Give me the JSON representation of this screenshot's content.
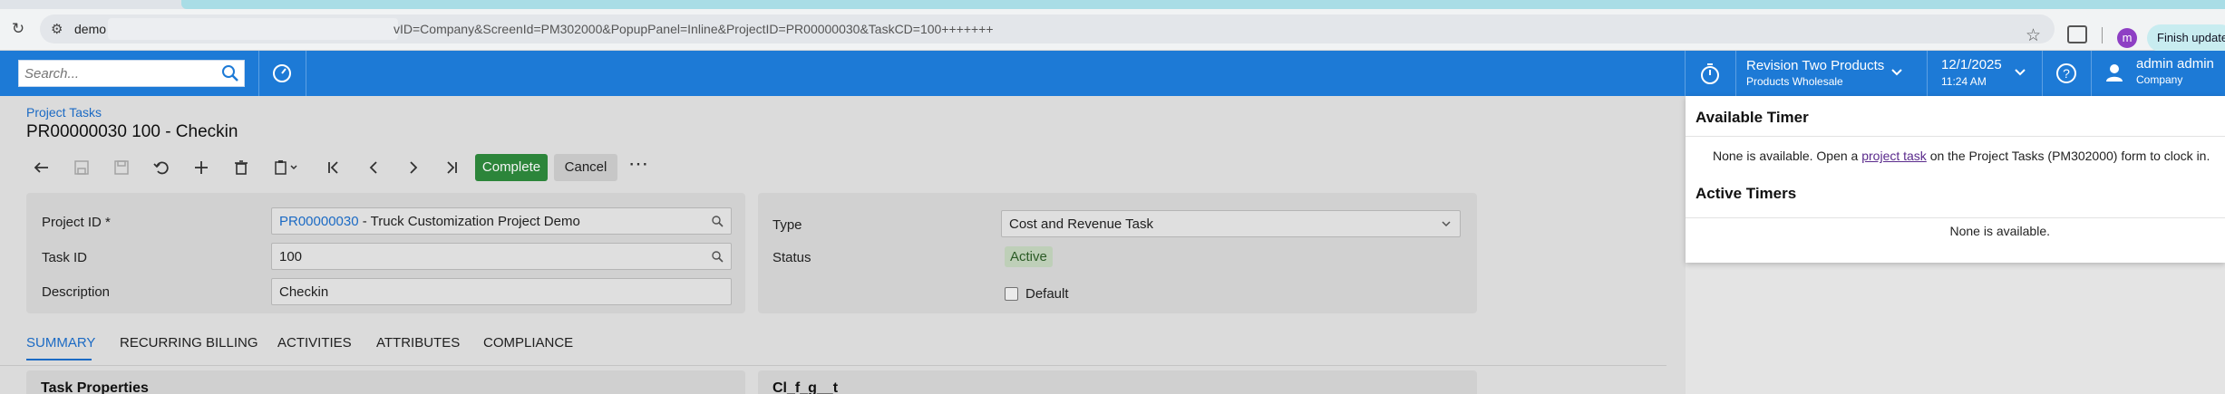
{
  "browser": {
    "url_host": "demo",
    "url_path": "vID=Company&ScreenId=PM302000&PopupPanel=Inline&ProjectID=PR00000030&TaskCD=100+++++++",
    "profile_initial": "m",
    "finish_update_label": "Finish update"
  },
  "header": {
    "search_placeholder": "Search...",
    "company_name": "Revision Two Products",
    "company_branch": "Products Wholesale",
    "date": "12/1/2025",
    "time": "11:24 AM",
    "user_name": "admin admin",
    "user_company": "Company"
  },
  "page": {
    "breadcrumb": "Project Tasks",
    "title": "PR00000030 100 - Checkin"
  },
  "toolbar": {
    "complete_label": "Complete",
    "cancel_label": "Cancel",
    "more_label": "⋯"
  },
  "form": {
    "project_id_label": "Project ID *",
    "project_id_value": "PR00000030",
    "project_id_desc": " - Truck Customization Project Demo",
    "task_id_label": "Task ID",
    "task_id_value": "100",
    "description_label": "Description",
    "description_value": "Checkin",
    "type_label": "Type",
    "type_value": "Cost and Revenue Task",
    "status_label": "Status",
    "status_value": "Active",
    "default_label": "Default"
  },
  "tabs": [
    {
      "label": "SUMMARY",
      "active": true
    },
    {
      "label": "RECURRING BILLING",
      "active": false
    },
    {
      "label": "ACTIVITIES",
      "active": false
    },
    {
      "label": "ATTRIBUTES",
      "active": false
    },
    {
      "label": "COMPLIANCE",
      "active": false
    }
  ],
  "sections": {
    "left_title": "Task Properties",
    "right_title": "Cl_f_g__t"
  },
  "popup": {
    "available_title": "Available Timer",
    "available_msg_pre": "None is available. Open a ",
    "available_msg_link": "project task",
    "available_msg_post": " on the Project Tasks (PM302000) form to clock in.",
    "active_title": "Active Timers",
    "active_msg": "None is available."
  },
  "colors": {
    "header_blue": "#1d7ad6",
    "complete_green": "#2e8b3d",
    "link_blue": "#1d6fcc",
    "status_badge": "#c6d8c0"
  }
}
